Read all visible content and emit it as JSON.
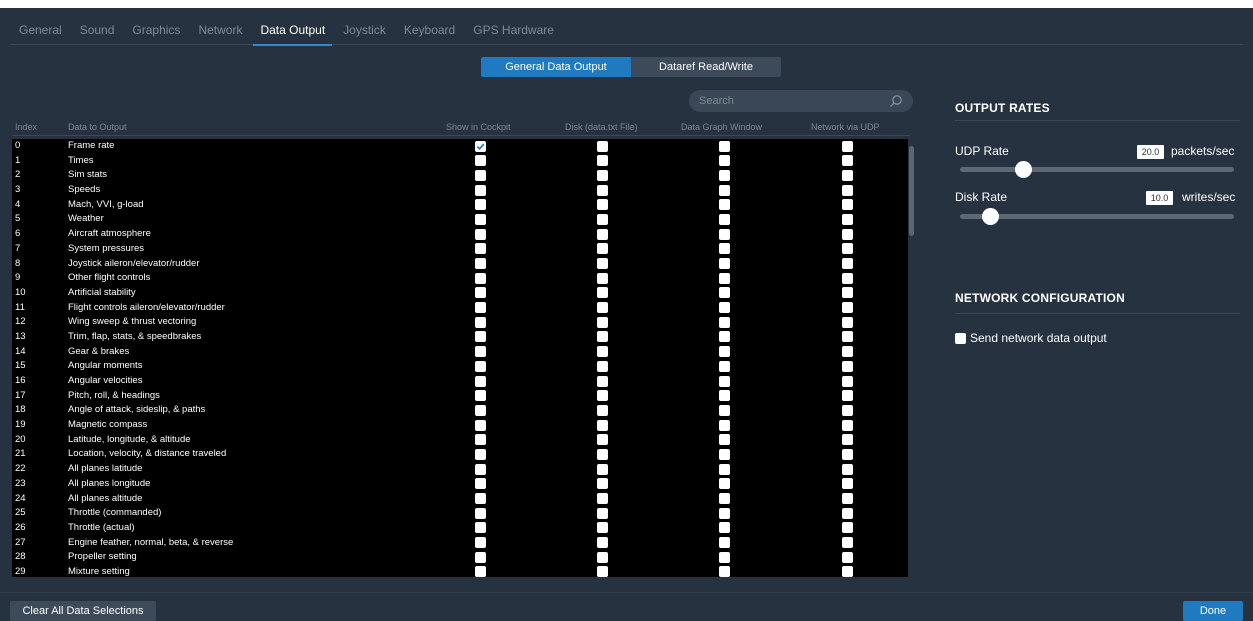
{
  "tabs": [
    {
      "label": "General",
      "active": false
    },
    {
      "label": "Sound",
      "active": false
    },
    {
      "label": "Graphics",
      "active": false
    },
    {
      "label": "Network",
      "active": false
    },
    {
      "label": "Data Output",
      "active": true
    },
    {
      "label": "Joystick",
      "active": false
    },
    {
      "label": "Keyboard",
      "active": false
    },
    {
      "label": "GPS Hardware",
      "active": false
    }
  ],
  "segmented": {
    "selected": "General Data Output",
    "other": "Dataref Read/Write"
  },
  "search": {
    "placeholder": "Search"
  },
  "table": {
    "headers": {
      "index": "Index",
      "data": "Data to Output",
      "cockpit": "Show in Cockpit",
      "disk": "Disk (data.txt File)",
      "graph": "Data Graph Window",
      "udp": "Network via UDP"
    },
    "rows": [
      {
        "index": "0",
        "label": "Frame rate",
        "cockpit": true,
        "disk": false,
        "graph": false,
        "udp": false
      },
      {
        "index": "1",
        "label": "Times",
        "cockpit": false,
        "disk": false,
        "graph": false,
        "udp": false
      },
      {
        "index": "2",
        "label": "Sim stats",
        "cockpit": false,
        "disk": false,
        "graph": false,
        "udp": false
      },
      {
        "index": "3",
        "label": "Speeds",
        "cockpit": false,
        "disk": false,
        "graph": false,
        "udp": false
      },
      {
        "index": "4",
        "label": "Mach, VVI, g-load",
        "cockpit": false,
        "disk": false,
        "graph": false,
        "udp": false
      },
      {
        "index": "5",
        "label": "Weather",
        "cockpit": false,
        "disk": false,
        "graph": false,
        "udp": false
      },
      {
        "index": "6",
        "label": "Aircraft atmosphere",
        "cockpit": false,
        "disk": false,
        "graph": false,
        "udp": false
      },
      {
        "index": "7",
        "label": "System pressures",
        "cockpit": false,
        "disk": false,
        "graph": false,
        "udp": false
      },
      {
        "index": "8",
        "label": "Joystick aileron/elevator/rudder",
        "cockpit": false,
        "disk": false,
        "graph": false,
        "udp": false
      },
      {
        "index": "9",
        "label": "Other flight controls",
        "cockpit": false,
        "disk": false,
        "graph": false,
        "udp": false
      },
      {
        "index": "10",
        "label": "Artificial stability",
        "cockpit": false,
        "disk": false,
        "graph": false,
        "udp": false
      },
      {
        "index": "11",
        "label": "Flight controls aileron/elevator/rudder",
        "cockpit": false,
        "disk": false,
        "graph": false,
        "udp": false
      },
      {
        "index": "12",
        "label": "Wing sweep & thrust vectoring",
        "cockpit": false,
        "disk": false,
        "graph": false,
        "udp": false
      },
      {
        "index": "13",
        "label": "Trim, flap, stats, & speedbrakes",
        "cockpit": false,
        "disk": false,
        "graph": false,
        "udp": false
      },
      {
        "index": "14",
        "label": "Gear & brakes",
        "cockpit": false,
        "disk": false,
        "graph": false,
        "udp": false
      },
      {
        "index": "15",
        "label": "Angular moments",
        "cockpit": false,
        "disk": false,
        "graph": false,
        "udp": false
      },
      {
        "index": "16",
        "label": "Angular velocities",
        "cockpit": false,
        "disk": false,
        "graph": false,
        "udp": false
      },
      {
        "index": "17",
        "label": "Pitch, roll, & headings",
        "cockpit": false,
        "disk": false,
        "graph": false,
        "udp": false
      },
      {
        "index": "18",
        "label": "Angle of attack, sideslip, & paths",
        "cockpit": false,
        "disk": false,
        "graph": false,
        "udp": false
      },
      {
        "index": "19",
        "label": "Magnetic compass",
        "cockpit": false,
        "disk": false,
        "graph": false,
        "udp": false
      },
      {
        "index": "20",
        "label": "Latitude, longitude, & altitude",
        "cockpit": false,
        "disk": false,
        "graph": false,
        "udp": false
      },
      {
        "index": "21",
        "label": "Location, velocity, & distance traveled",
        "cockpit": false,
        "disk": false,
        "graph": false,
        "udp": false
      },
      {
        "index": "22",
        "label": "All planes latitude",
        "cockpit": false,
        "disk": false,
        "graph": false,
        "udp": false
      },
      {
        "index": "23",
        "label": "All planes longitude",
        "cockpit": false,
        "disk": false,
        "graph": false,
        "udp": false
      },
      {
        "index": "24",
        "label": "All planes altitude",
        "cockpit": false,
        "disk": false,
        "graph": false,
        "udp": false
      },
      {
        "index": "25",
        "label": "Throttle (commanded)",
        "cockpit": false,
        "disk": false,
        "graph": false,
        "udp": false
      },
      {
        "index": "26",
        "label": "Throttle (actual)",
        "cockpit": false,
        "disk": false,
        "graph": false,
        "udp": false
      },
      {
        "index": "27",
        "label": "Engine feather, normal, beta, & reverse",
        "cockpit": false,
        "disk": false,
        "graph": false,
        "udp": false
      },
      {
        "index": "28",
        "label": "Propeller setting",
        "cockpit": false,
        "disk": false,
        "graph": false,
        "udp": false
      },
      {
        "index": "29",
        "label": "Mixture setting",
        "cockpit": false,
        "disk": false,
        "graph": false,
        "udp": false
      }
    ]
  },
  "output_rates": {
    "title": "OUTPUT RATES",
    "udp": {
      "label": "UDP Rate",
      "value": "20.0",
      "unit": "packets/sec",
      "slider_fraction": 0.23
    },
    "disk": {
      "label": "Disk Rate",
      "value": "10.0",
      "unit": "writes/sec",
      "slider_fraction": 0.11
    }
  },
  "network_config": {
    "title": "NETWORK CONFIGURATION",
    "send_label": "Send network data output",
    "send_checked": false
  },
  "buttons": {
    "clear": "Clear All Data Selections",
    "done": "Done"
  },
  "icons": {
    "search": "search-icon",
    "check": "check-icon"
  },
  "colors": {
    "accent": "#1f7ac0",
    "background": "#263240",
    "table_bg": "#000000"
  }
}
